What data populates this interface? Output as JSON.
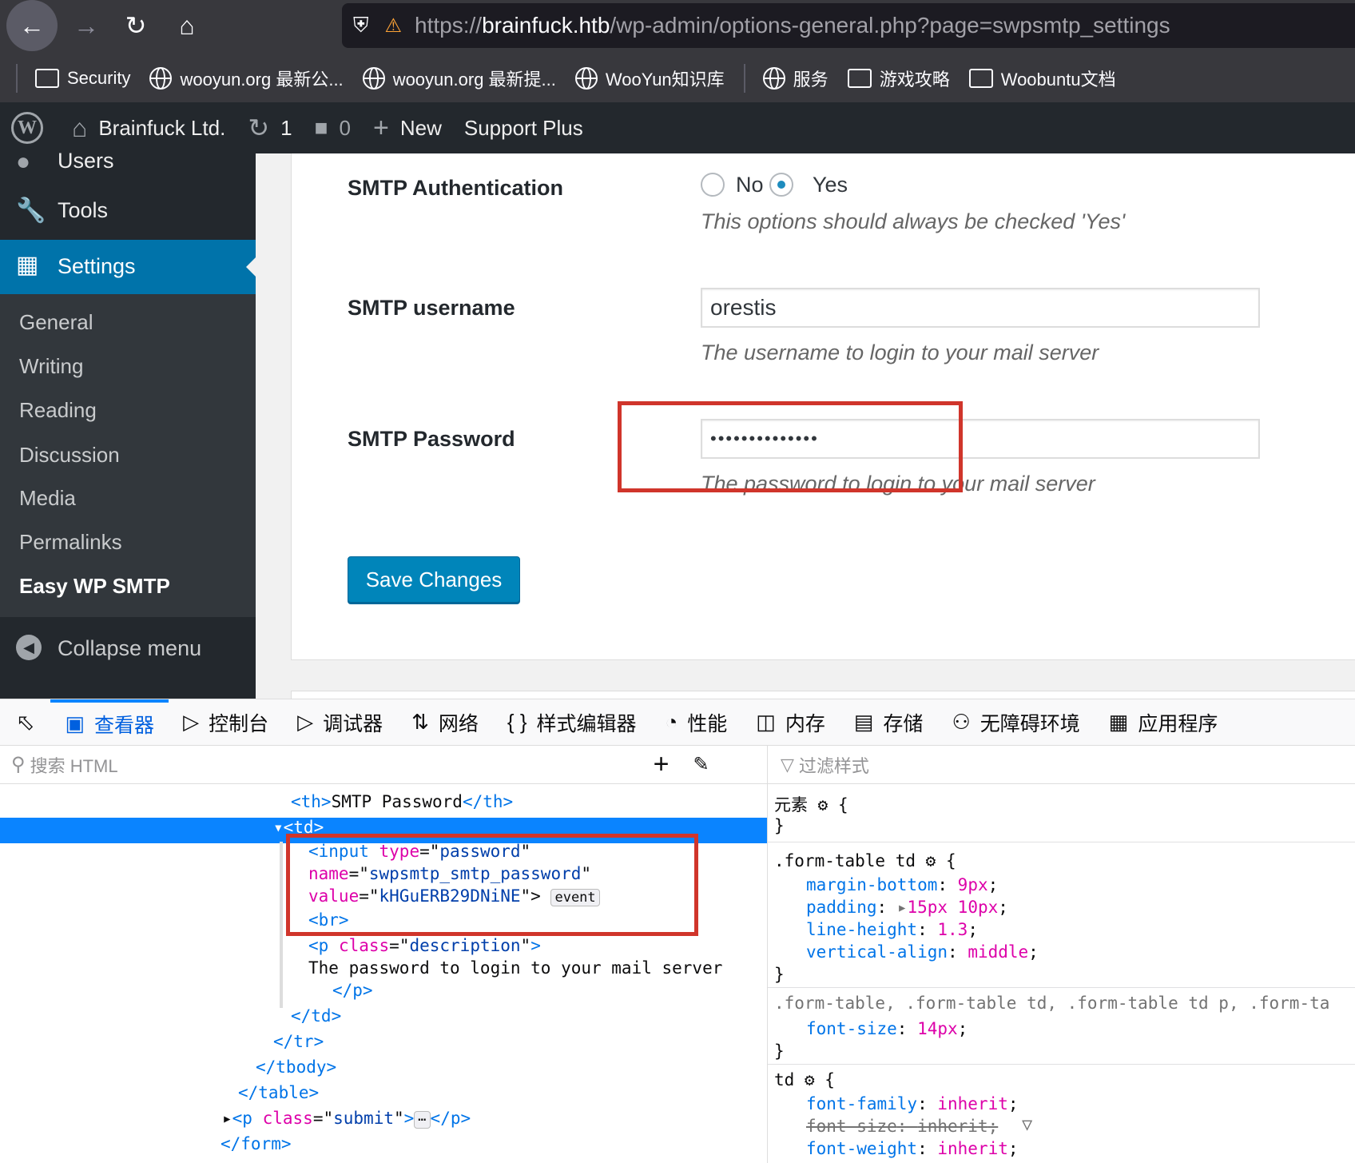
{
  "browser": {
    "url_proto": "https://",
    "url_host": "brainfuck.htb",
    "url_path": "/wp-admin/options-general.php?page=swpsmtp_settings",
    "bookmarks": [
      "Security",
      "wooyun.org 最新公...",
      "wooyun.org 最新提...",
      "WooYun知识库",
      "服务",
      "游戏攻略",
      "Woobuntu文档"
    ]
  },
  "adminbar": {
    "site_name": "Brainfuck Ltd.",
    "updates_count": "1",
    "comments_count": "0",
    "new_label": "New",
    "support_label": "Support Plus"
  },
  "sidebar": {
    "users_label": "Users",
    "tools_label": "Tools",
    "settings_label": "Settings",
    "submenu": [
      "General",
      "Writing",
      "Reading",
      "Discussion",
      "Media",
      "Permalinks",
      "Easy WP SMTP"
    ],
    "collapse_label": "Collapse menu"
  },
  "form": {
    "auth_label": "SMTP Authentication",
    "auth_no": "No",
    "auth_yes": "Yes",
    "auth_selected": "Yes",
    "auth_desc": "This options should always be checked 'Yes'",
    "username_label": "SMTP username",
    "username_value": "orestis",
    "username_desc": "The username to login to your mail server",
    "password_label": "SMTP Password",
    "password_mask": "••••••••••••••",
    "password_desc": "The password to login to your mail server",
    "save_label": "Save Changes"
  },
  "devtools": {
    "tabs": [
      "查看器",
      "控制台",
      "调试器",
      "网络",
      "样式编辑器",
      "性能",
      "内存",
      "存储",
      "无障碍环境",
      "应用程序"
    ],
    "selected_tab": "查看器",
    "search_placeholder": "搜索 HTML",
    "filter_placeholder": "过滤样式",
    "markup": {
      "th_text": "SMTP Password",
      "input_type": "password",
      "input_name": "swpsmtp_smtp_password",
      "input_value": "kHGuERB29DNiNE",
      "event_badge": "event",
      "p_class": "description",
      "p_text": "The password to login to your mail server",
      "submit_class": "submit"
    },
    "rules": {
      "element_label": "元素",
      "rule1_selector": ".form-table td",
      "rule1_props": [
        {
          "name": "margin-bottom",
          "value": "9px"
        },
        {
          "name": "padding",
          "value": "15px 10px"
        },
        {
          "name": "line-height",
          "value": "1.3"
        },
        {
          "name": "vertical-align",
          "value": "middle"
        }
      ],
      "rule2_selector": ".form-table, .form-table td, .form-table td p, .form-ta",
      "rule2_prop": {
        "name": "font-size",
        "value": "14px"
      },
      "rule3_selector": "td",
      "rule3_props": [
        {
          "name": "font-family",
          "value": "inherit"
        },
        {
          "name": "font-size",
          "value": "inherit"
        },
        {
          "name": "font-weight",
          "value": "inherit"
        }
      ]
    }
  },
  "colors": {
    "wp_blue": "#0073aa",
    "highlight_red": "#d0352b",
    "devtools_select": "#0a84ff"
  }
}
